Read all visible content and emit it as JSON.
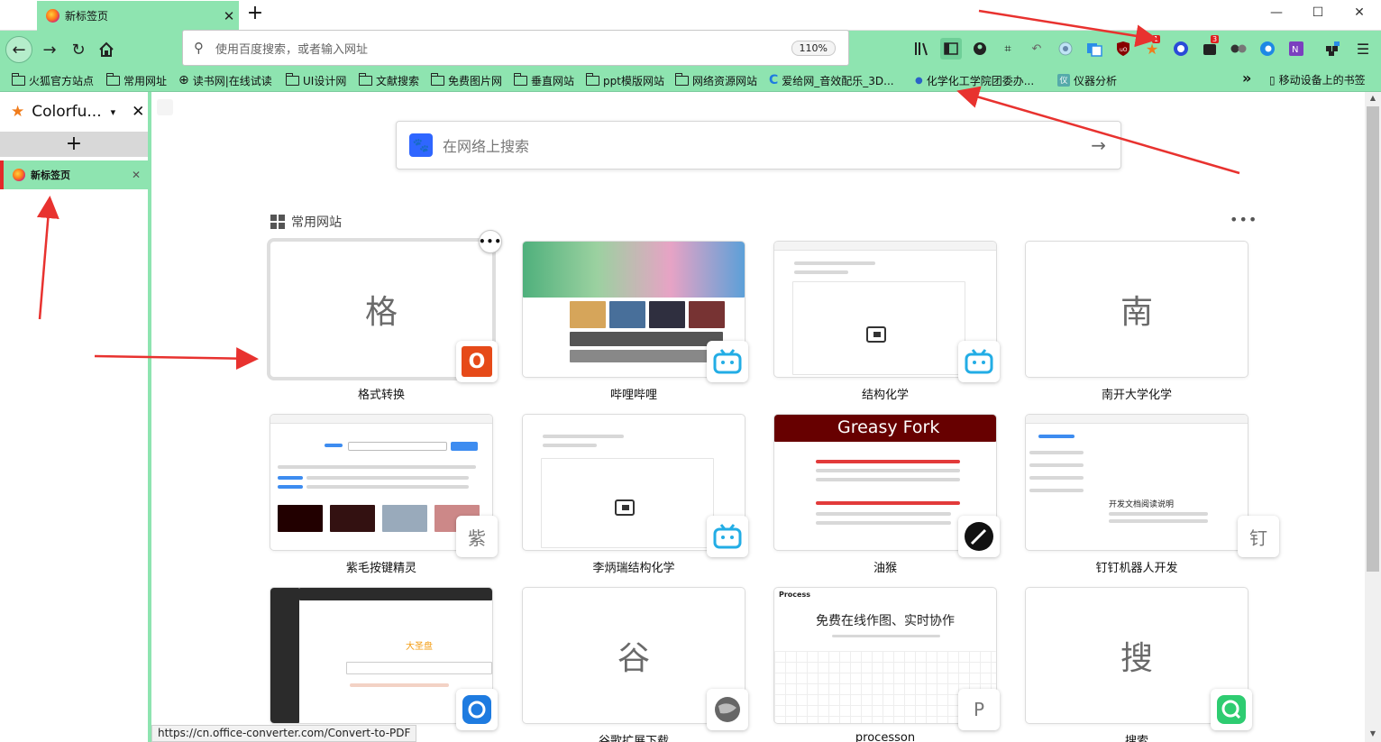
{
  "window": {
    "tab_title": "新标签页",
    "new_tab": "+",
    "minimize": "—",
    "maximize": "☐",
    "close": "✕"
  },
  "nav": {
    "search_placeholder": "使用百度搜索，或者输入网址",
    "zoom": "110%"
  },
  "toolbar_badges": {
    "ext1": "1",
    "ext2": "3"
  },
  "bookmarks": {
    "items": [
      "火狐官方站点",
      "常用网址",
      "读书网|在线试读",
      "UI设计网",
      "文献搜索",
      "免费图片网",
      "垂直网站",
      "ppt模版网站",
      "网络资源网站",
      "爱给网_音效配乐_3D...",
      "化学化工学院团委办...",
      "仪器分析"
    ],
    "more": "»",
    "mobile": "移动设备上的书签"
  },
  "sidebar": {
    "title": "Colorfu...",
    "new_tab": "+",
    "tab_title": "新标签页"
  },
  "content": {
    "search_placeholder": "在网络上搜索",
    "top_sites_title": "常用网站",
    "sites": [
      {
        "label": "格式转换",
        "letter": "格",
        "badge": "O"
      },
      {
        "label": "哔哩哔哩"
      },
      {
        "label": "结构化学"
      },
      {
        "label": "南开大学化学",
        "letter": "南"
      },
      {
        "label": "紫毛按键精灵",
        "badge": "紫"
      },
      {
        "label": "李炳瑞结构化学"
      },
      {
        "label": "油猴",
        "header": "Greasy Fork"
      },
      {
        "label": "钉钉机器人开发",
        "badge": "钉",
        "heading": "开发文档阅读说明"
      },
      {
        "label": "",
        "logo": "大圣盘"
      },
      {
        "label": "谷歌扩展下载",
        "letter": "谷"
      },
      {
        "label": "processon",
        "badge": "P",
        "headline": "免费在线作图、实时协作",
        "brand": "Process"
      },
      {
        "label": "搜索",
        "letter": "搜"
      }
    ]
  },
  "status": {
    "url": "https://cn.office-converter.com/Convert-to-PDF"
  },
  "colors": {
    "accent_green": "#8ee4b0",
    "active_marker": "#e32a2a",
    "arrow_red": "#e8322f"
  }
}
